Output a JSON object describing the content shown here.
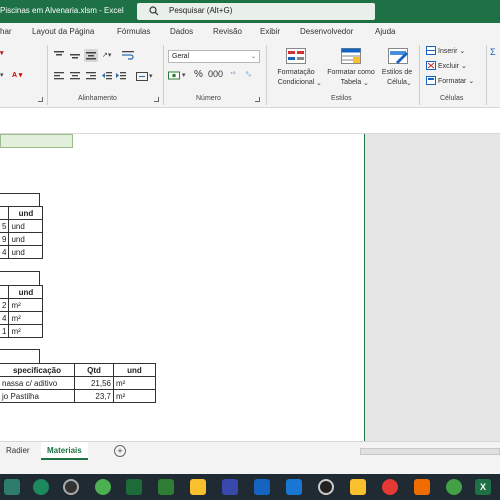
{
  "window": {
    "title": "Piscinas em Alvenaria.xlsm  -  Excel",
    "search_placeholder": "Pesquisar (Alt+G)"
  },
  "ribbon_tabs": [
    "har",
    "Layout da Página",
    "Fórmulas",
    "Dados",
    "Revisão",
    "Exibir",
    "Desenvolvedor",
    "Ajuda"
  ],
  "ribbon": {
    "alinhamento_label": "Alinhamento",
    "numero_label": "Número",
    "number_format": "Geral",
    "estilos_label": "Estilos",
    "celulas_label": "Células",
    "formatacao_condicional": [
      "Formatação",
      "Condicional"
    ],
    "formatar_tabela": [
      "Formatar como",
      "Tabela"
    ],
    "estilos_celula": [
      "Estilos de",
      "Célula"
    ],
    "inserir": "Inserir",
    "excluir": "Excluir",
    "formatar": "Formatar"
  },
  "table1": {
    "header": [
      "",
      "und"
    ],
    "rows": [
      [
        "5",
        "und"
      ],
      [
        "9",
        "und"
      ],
      [
        "4",
        "und"
      ]
    ]
  },
  "table2": {
    "header": [
      "",
      "und"
    ],
    "rows": [
      [
        "2",
        "m²"
      ],
      [
        "4",
        "m²"
      ],
      [
        "1",
        "m²"
      ]
    ]
  },
  "table3": {
    "header": [
      "specificação",
      "Qtd",
      "und"
    ],
    "rows": [
      [
        "nassa c/ aditivo",
        "21,56",
        "m²"
      ],
      [
        "jo Pastilha",
        "23,7",
        "m²"
      ]
    ]
  },
  "sheet_tabs": [
    "Radier",
    "Materiais"
  ],
  "active_sheet": "Materiais",
  "colors": {
    "excel_green": "#1e7145",
    "accent_light_green": "#e2efda"
  }
}
